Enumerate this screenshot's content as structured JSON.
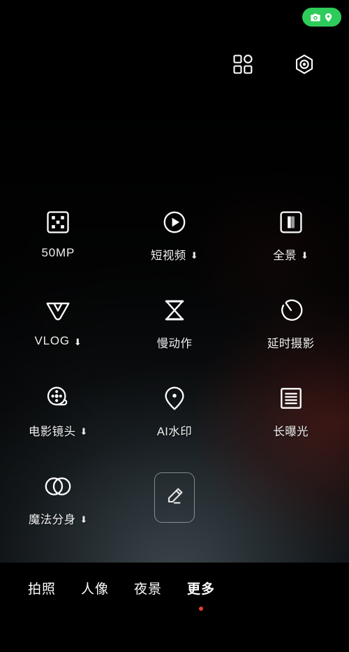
{
  "statusbar": {
    "privacy_indicator": {
      "camera_icon": "camera-icon",
      "location_icon": "location-pin-icon",
      "color": "#2ECC5A"
    }
  },
  "top_controls": [
    {
      "name": "filters-button",
      "icon": "grid-filters-icon"
    },
    {
      "name": "settings-button",
      "icon": "hexagon-aperture-icon"
    }
  ],
  "modes": [
    [
      {
        "label": "50MP",
        "icon": "sensor-grid-icon",
        "latin": true,
        "download": false
      },
      {
        "label": "短视频",
        "icon": "play-circle-icon",
        "latin": false,
        "download": true
      },
      {
        "label": "全景",
        "icon": "panorama-icon",
        "latin": false,
        "download": true
      }
    ],
    [
      {
        "label": "VLOG",
        "icon": "vlog-v-icon",
        "latin": true,
        "download": true
      },
      {
        "label": "慢动作",
        "icon": "hourglass-icon",
        "latin": false,
        "download": false
      },
      {
        "label": "延时摄影",
        "icon": "timelapse-clock-icon",
        "latin": false,
        "download": false
      }
    ],
    [
      {
        "label": "电影镜头",
        "icon": "film-reel-icon",
        "latin": false,
        "download": true
      },
      {
        "label": "AI水印",
        "icon": "location-pin-icon",
        "latin": false,
        "download": false
      },
      {
        "label": "长曝光",
        "icon": "long-exposure-icon",
        "latin": false,
        "download": false
      }
    ],
    [
      {
        "label": "魔法分身",
        "icon": "overlapping-circles-icon",
        "latin": false,
        "download": true
      },
      {
        "label": "",
        "icon": "pencil-edit-icon",
        "latin": false,
        "download": false
      },
      {
        "label": "",
        "icon": "",
        "latin": false,
        "download": false
      }
    ]
  ],
  "download_badge_glyph": "⬇",
  "bottom_tabs": [
    {
      "label": "拍照",
      "active": false
    },
    {
      "label": "人像",
      "active": false
    },
    {
      "label": "夜景",
      "active": false
    },
    {
      "label": "更多",
      "active": true
    }
  ],
  "accent": {
    "active_dot": "#E8402A",
    "privacy_green": "#2ECC5A",
    "icon_stroke": "#FFFFFF",
    "label_text": "#F0F0F0"
  }
}
